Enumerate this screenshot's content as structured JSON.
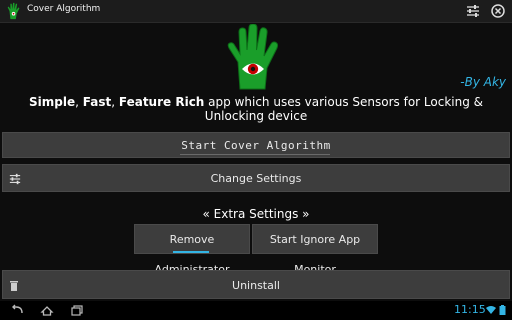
{
  "window": {
    "title": "Cover Algorithm"
  },
  "header": {
    "byline": "-By Aky"
  },
  "tagline": {
    "part1": "Simple",
    "sep1": ", ",
    "part2": "Fast",
    "sep2": ", ",
    "part3": "Feature Rich",
    "rest": " app which uses various Sensors for Locking & Unlocking device"
  },
  "buttons": {
    "start": "Start Cover Algorithm",
    "change_settings": "Change Settings",
    "remove_admin": "Remove Administrator",
    "ignore_monitor": "Start Ignore App Monitor",
    "uninstall": "Uninstall"
  },
  "extra_settings": {
    "title": "« Extra Settings »"
  },
  "statusbar": {
    "time": "11:15"
  },
  "colors": {
    "accent": "#33b5e5",
    "logo": "#1a9e2a",
    "button_bg": "#3d3d3d"
  },
  "icons": [
    "app-hand-icon",
    "sliders-icon",
    "close-icon",
    "trash-icon",
    "back-icon",
    "home-icon",
    "recents-icon",
    "wifi-icon",
    "battery-icon"
  ]
}
